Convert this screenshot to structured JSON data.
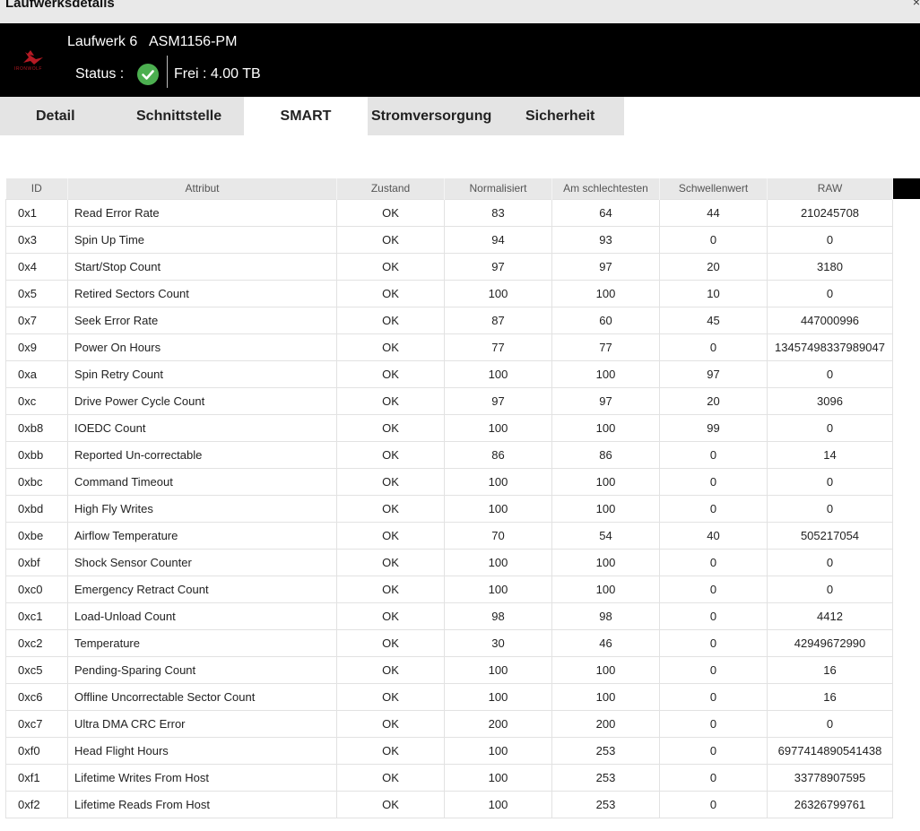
{
  "window": {
    "title": "Laufwerksdetails",
    "close_glyph": "×"
  },
  "header": {
    "brand_text": "IRONWOLF",
    "drive_name": "Laufwerk 6",
    "drive_model": "ASM1156-PM",
    "status_label": "Status :",
    "status_icon": "check-circle-icon",
    "status_color": "#4caf50",
    "free_label": "Frei : 4.00 TB"
  },
  "tabs": [
    {
      "label": "Detail"
    },
    {
      "label": "Schnittstelle"
    },
    {
      "label": "SMART"
    },
    {
      "label": "Stromversorgung"
    },
    {
      "label": "Sicherheit"
    }
  ],
  "active_tab": "SMART",
  "table": {
    "columns": [
      "ID",
      "Attribut",
      "Zustand",
      "Normalisiert",
      "Am schlechtesten",
      "Schwellenwert",
      "RAW"
    ],
    "rows": [
      [
        "0x1",
        "Read Error Rate",
        "OK",
        "83",
        "64",
        "44",
        "210245708"
      ],
      [
        "0x3",
        "Spin Up Time",
        "OK",
        "94",
        "93",
        "0",
        "0"
      ],
      [
        "0x4",
        "Start/Stop Count",
        "OK",
        "97",
        "97",
        "20",
        "3180"
      ],
      [
        "0x5",
        "Retired Sectors Count",
        "OK",
        "100",
        "100",
        "10",
        "0"
      ],
      [
        "0x7",
        "Seek Error Rate",
        "OK",
        "87",
        "60",
        "45",
        "447000996"
      ],
      [
        "0x9",
        "Power On Hours",
        "OK",
        "77",
        "77",
        "0",
        "13457498337989047"
      ],
      [
        "0xa",
        "Spin Retry Count",
        "OK",
        "100",
        "100",
        "97",
        "0"
      ],
      [
        "0xc",
        "Drive Power Cycle Count",
        "OK",
        "97",
        "97",
        "20",
        "3096"
      ],
      [
        "0xb8",
        "IOEDC Count",
        "OK",
        "100",
        "100",
        "99",
        "0"
      ],
      [
        "0xbb",
        "Reported Un-correctable",
        "OK",
        "86",
        "86",
        "0",
        "14"
      ],
      [
        "0xbc",
        "Command Timeout",
        "OK",
        "100",
        "100",
        "0",
        "0"
      ],
      [
        "0xbd",
        "High Fly Writes",
        "OK",
        "100",
        "100",
        "0",
        "0"
      ],
      [
        "0xbe",
        "Airflow Temperature",
        "OK",
        "70",
        "54",
        "40",
        "505217054"
      ],
      [
        "0xbf",
        "Shock Sensor Counter",
        "OK",
        "100",
        "100",
        "0",
        "0"
      ],
      [
        "0xc0",
        "Emergency Retract Count",
        "OK",
        "100",
        "100",
        "0",
        "0"
      ],
      [
        "0xc1",
        "Load-Unload Count",
        "OK",
        "98",
        "98",
        "0",
        "4412"
      ],
      [
        "0xc2",
        "Temperature",
        "OK",
        "30",
        "46",
        "0",
        "42949672990"
      ],
      [
        "0xc5",
        "Pending-Sparing Count",
        "OK",
        "100",
        "100",
        "0",
        "16"
      ],
      [
        "0xc6",
        "Offline Uncorrectable Sector Count",
        "OK",
        "100",
        "100",
        "0",
        "16"
      ],
      [
        "0xc7",
        "Ultra DMA CRC Error",
        "OK",
        "200",
        "200",
        "0",
        "0"
      ],
      [
        "0xf0",
        "Head Flight Hours",
        "OK",
        "100",
        "253",
        "0",
        "6977414890541438"
      ],
      [
        "0xf1",
        "Lifetime Writes From Host",
        "OK",
        "100",
        "253",
        "0",
        "33778907595"
      ],
      [
        "0xf2",
        "Lifetime Reads From Host",
        "OK",
        "100",
        "253",
        "0",
        "26326799761"
      ]
    ],
    "highlighted_raw_rows": [
      "0xbb",
      "0xc5",
      "0xc6"
    ],
    "highlight_color": "#f8ec11"
  }
}
